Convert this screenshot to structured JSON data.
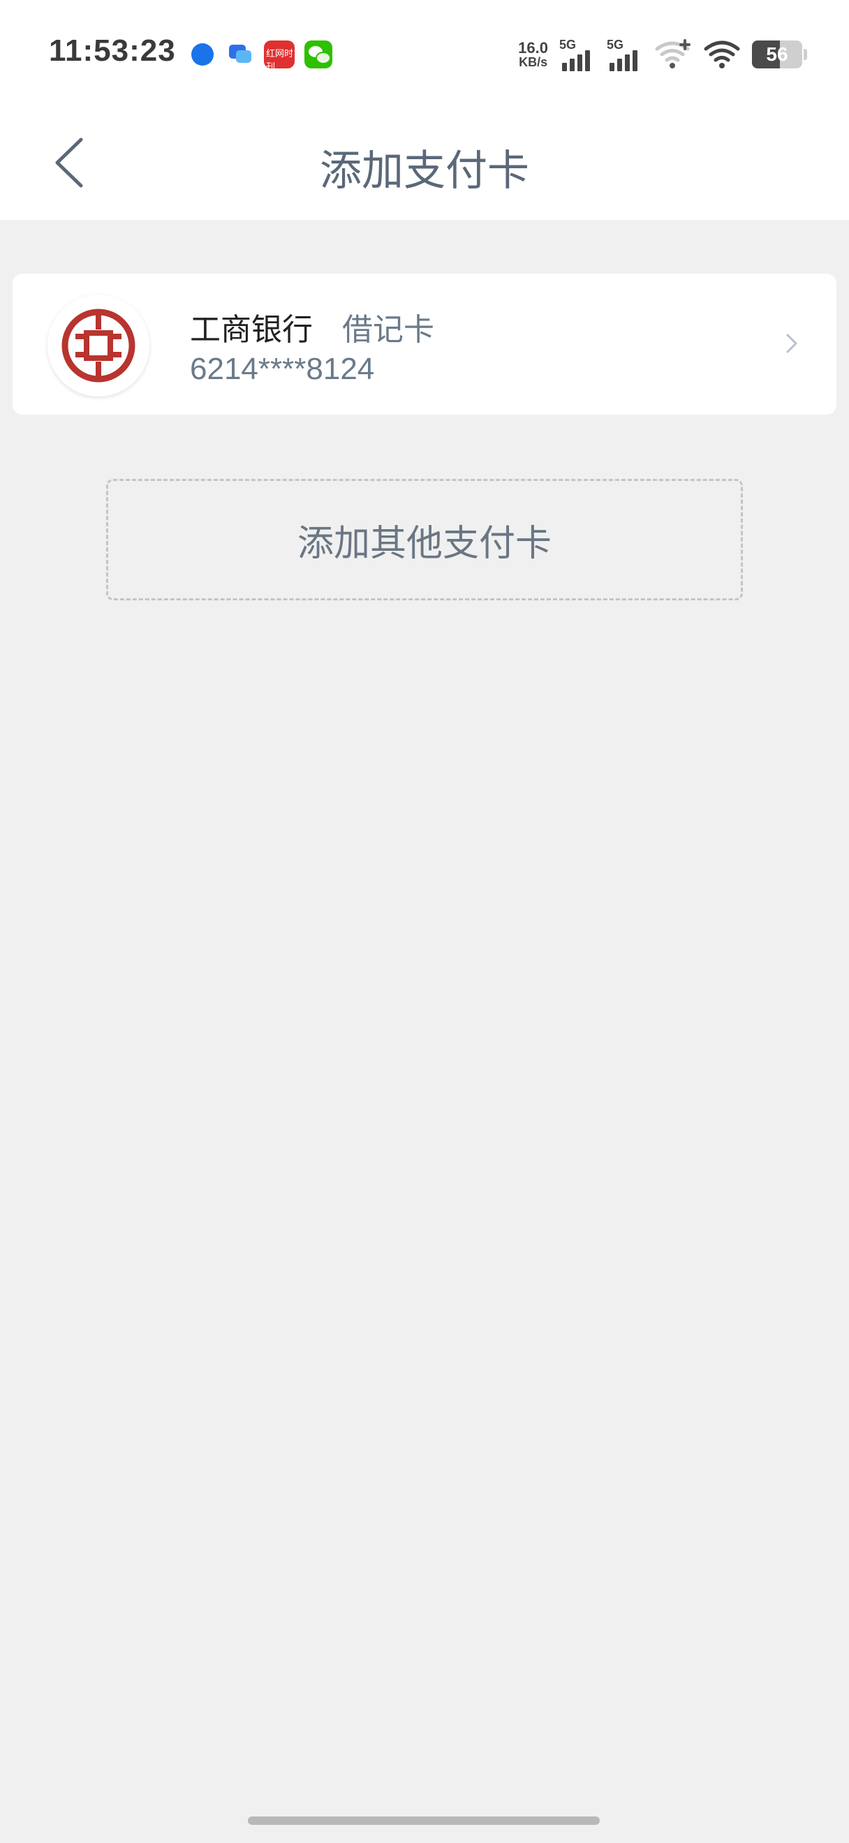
{
  "status_bar": {
    "time": "11:53:23",
    "notification_icons": [
      "dingtalk-icon",
      "chat-icon",
      "news-icon",
      "wechat-icon"
    ],
    "news_icon_text": "红网时刊",
    "net_speed_value": "16.0",
    "net_speed_unit": "KB/s",
    "signal1_label": "5G",
    "signal2_label": "5G",
    "battery_level": "56",
    "battery_percent": 56
  },
  "header": {
    "title": "添加支付卡",
    "back_icon": "chevron-left-icon"
  },
  "card": {
    "bank_name": "工商银行",
    "card_type": "借记卡",
    "card_number": "6214****8124",
    "logo_color": "#b8342f"
  },
  "add_other_card": {
    "label": "添加其他支付卡"
  },
  "colors": {
    "background": "#f0f0f0",
    "title": "#5a6878",
    "secondary_text": "#6a7a8a"
  }
}
